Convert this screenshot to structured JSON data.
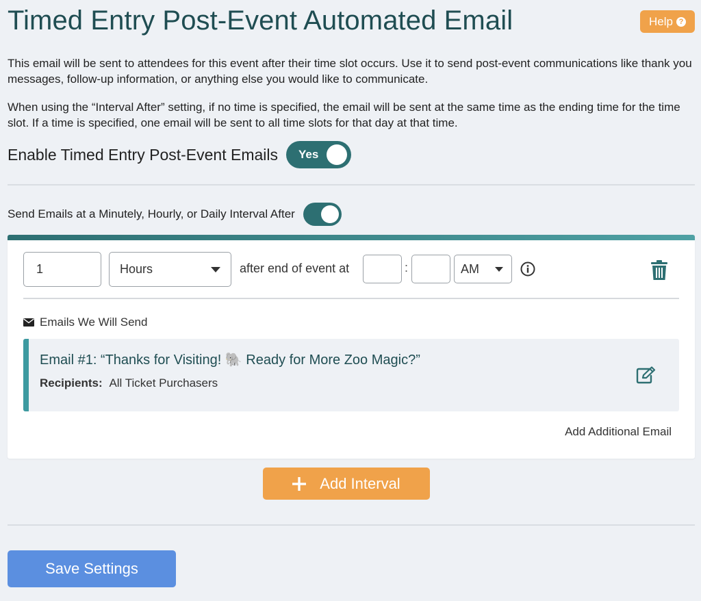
{
  "header": {
    "title": "Timed Entry Post-Event Automated Email",
    "help_label": "Help",
    "help_icon": "question-circle-icon"
  },
  "intro": {
    "paragraph_1": "This email will be sent to attendees for this event after their time slot occurs. Use it to send post-event communications like thank you messages, follow-up information, or anything else you would like to communicate.",
    "paragraph_2": "When using the “Interval After” setting, if no time is specified, the email will be sent at the same time as the ending time for the time slot. If a time is specified, one email will be sent to all time slots for that day at that time."
  },
  "enable": {
    "label": "Enable Timed Entry Post-Event Emails",
    "toggle_label": "Yes"
  },
  "interval_setting": {
    "label": "Send Emails at a Minutely, Hourly, or Daily Interval After"
  },
  "interval": {
    "amount": "1",
    "unit": "Hours",
    "after_text": "after end of event at",
    "hour": "",
    "minute": "",
    "time_separator": ":",
    "meridiem": "AM",
    "emails_heading": "Emails We Will Send",
    "emails": [
      {
        "title": "Email #1: “Thanks for Visiting! 🐘 Ready for More Zoo Magic?”",
        "recipients_label": "Recipients:",
        "recipients": "All Ticket Purchasers"
      }
    ],
    "add_email_label": "Add Additional Email"
  },
  "actions": {
    "add_interval_label": "Add Interval",
    "save_label": "Save Settings"
  },
  "colors": {
    "primary_teal": "#2d6f72",
    "accent_orange": "#f0a24a",
    "save_blue": "#5b8fe0",
    "background": "#eef1f5"
  }
}
